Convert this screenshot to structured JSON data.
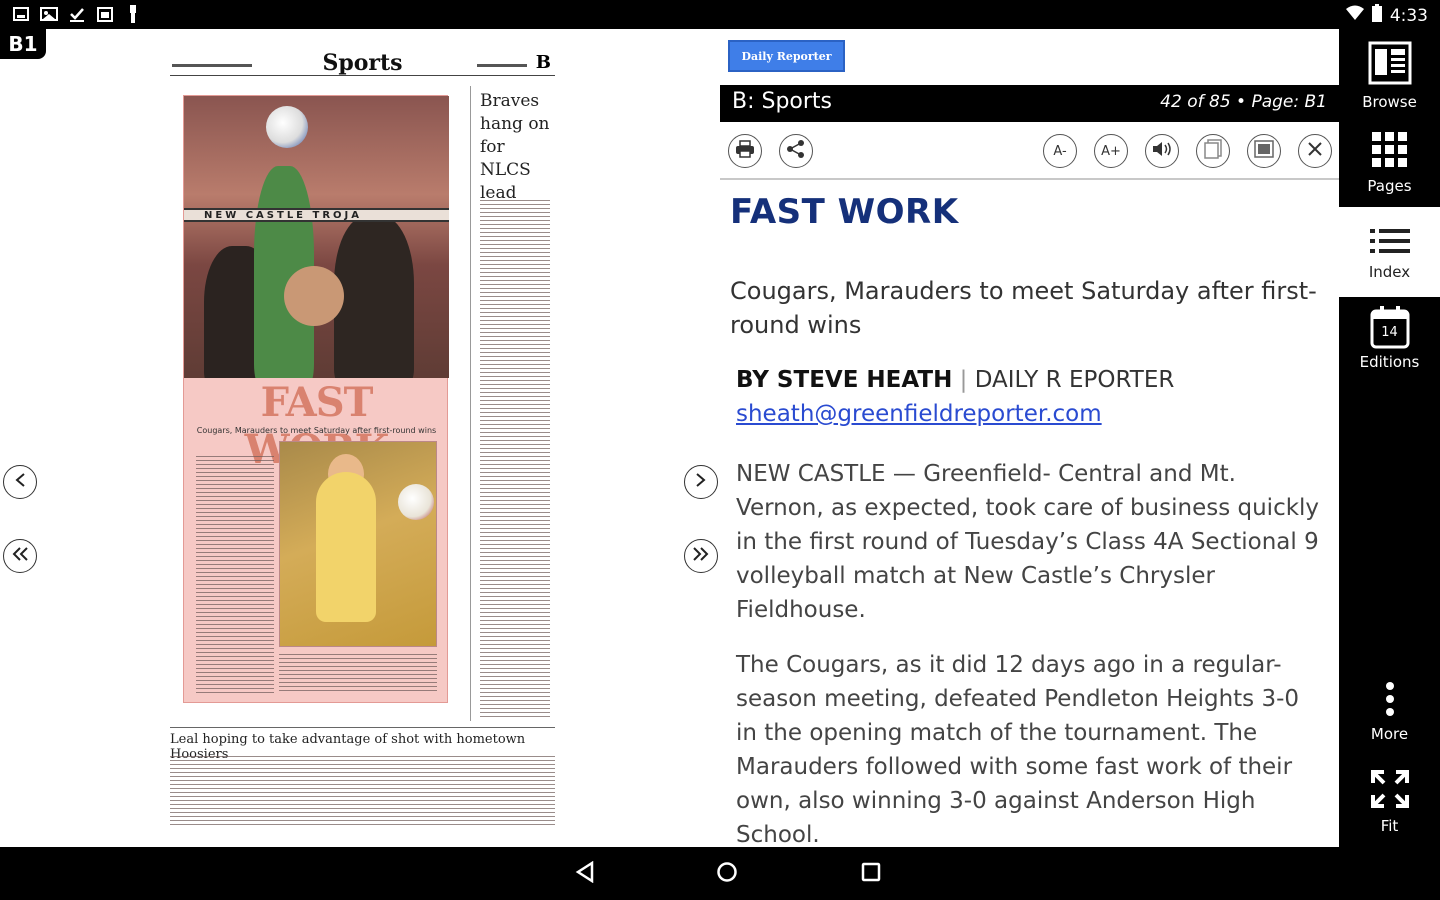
{
  "status_bar": {
    "time": "4:33",
    "left_icons": [
      "screenshot-icon",
      "photo-icon",
      "download-check-icon",
      "calendar-icon",
      "usb-icon"
    ],
    "right_icons": [
      "wifi-icon",
      "battery-icon"
    ]
  },
  "page_badge": "B1",
  "newspaper": {
    "section": "Sports",
    "section_letter": "B",
    "feature_headline": "FAST WORK",
    "feature_subhead": "Cougars, Marauders to meet Saturday after first-round wins",
    "net_text": "NEW CASTLE TROJA",
    "side_headline": "Braves hang on for NLCS lead",
    "bottom_headline": "Leal hoping to take advantage of shot with hometown Hoosiers"
  },
  "reader": {
    "brand": "Daily Reporter",
    "section": "B: Sports",
    "page_info": "42 of 85 • Page: B1",
    "tools": {
      "font_decrease": "A-",
      "font_increase": "A+"
    },
    "article": {
      "title": "FAST WORK",
      "deck": "Cougars, Marauders to meet Saturday after first-round wins",
      "author": "BY STEVE HEATH",
      "separator": "|",
      "outlet": "DAILY R EPORTER",
      "email": "sheath@greenfieldreporter.com",
      "paragraphs": [
        "NEW CASTLE — Greenfield- Central and Mt. Vernon, as expected, took care of business quickly in the first round of Tuesday’s Class 4A Sectional 9 volleyball match at New Castle’s Chrysler Fieldhouse.",
        "The Cougars, as it did 12 days ago in a regular-season meeting, defeated Pendleton Heights 3-0 in the opening match of the tournament. The Marauders followed with some fast work of their own, also winning 3-0 against Anderson High School."
      ]
    }
  },
  "sidebar": {
    "browse": "Browse",
    "pages": "Pages",
    "index": "Index",
    "editions": "Editions",
    "editions_day": "14",
    "more": "More",
    "fit": "Fit"
  },
  "colors": {
    "title_blue": "#15307a",
    "link_blue": "#2a4bd1",
    "brand_blue": "#3f7ee8",
    "feature_pink": "#f6c9c5"
  }
}
